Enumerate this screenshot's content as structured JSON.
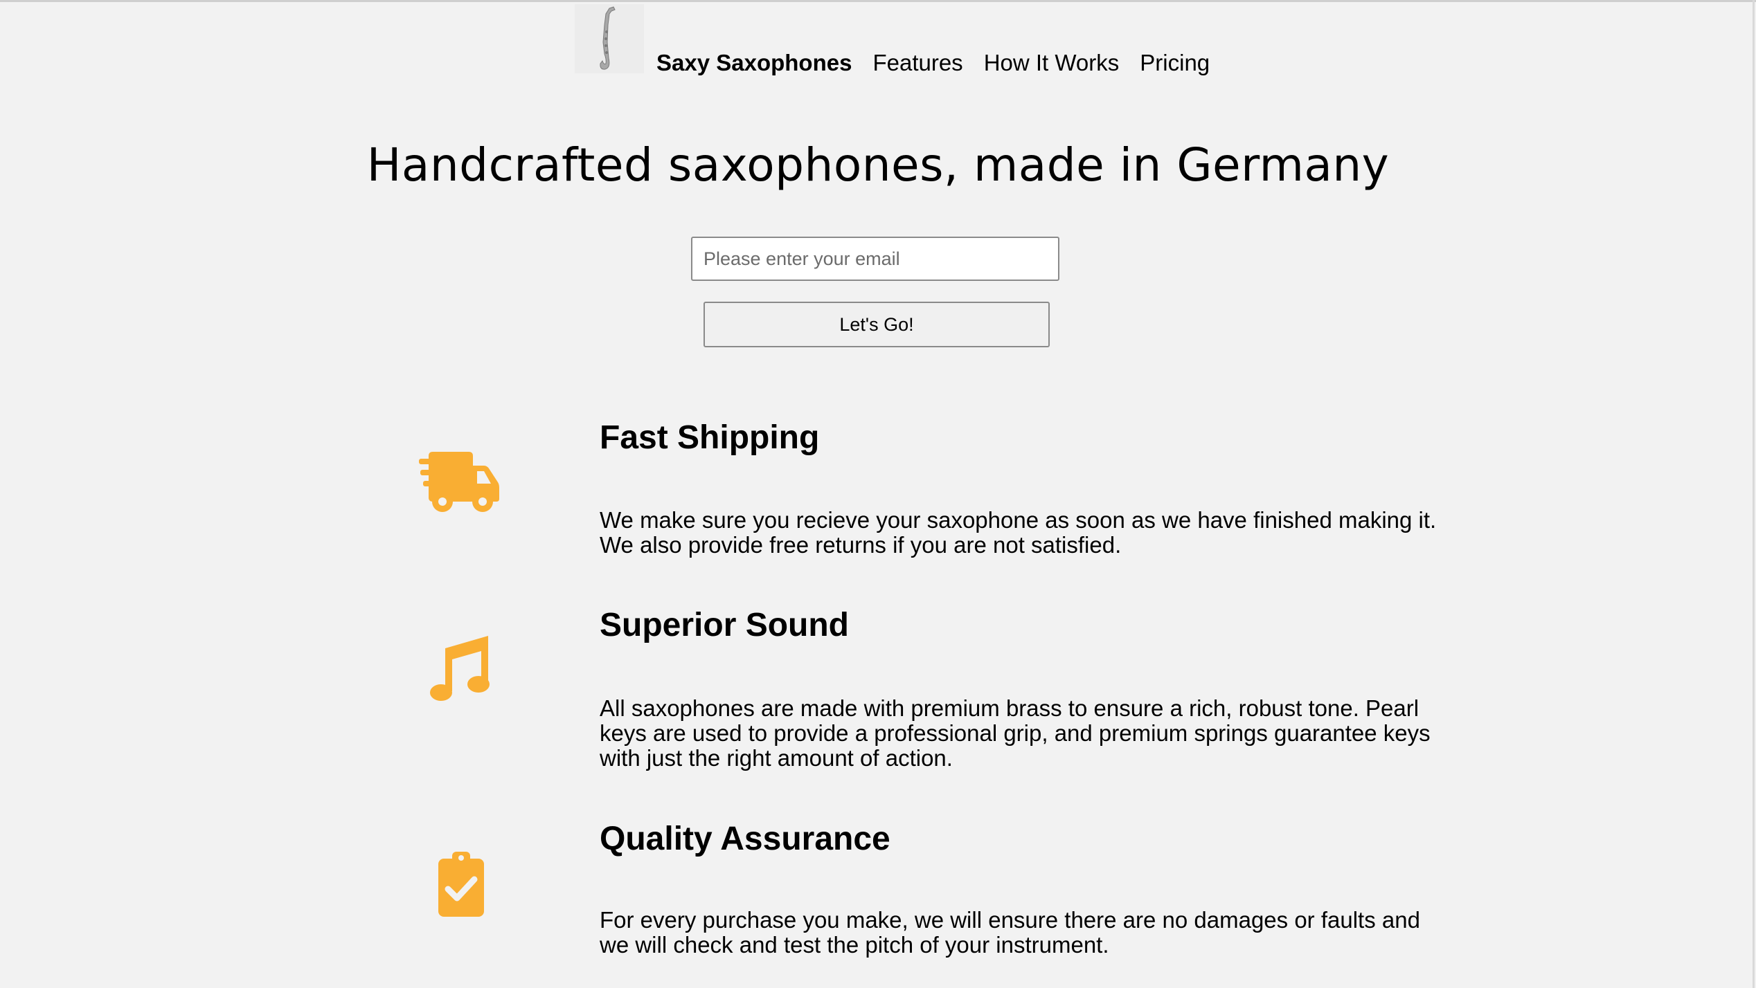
{
  "header": {
    "logo_icon": "saxophone-logo-image",
    "brand": "Saxy Saxophones",
    "nav": [
      "Features",
      "How It Works",
      "Pricing"
    ]
  },
  "hero": {
    "title": "Handcrafted saxophones, made in Germany",
    "email_placeholder": "Please enter your email",
    "button_label": "Let's Go!"
  },
  "features": [
    {
      "icon": "truck-icon",
      "title": "Fast Shipping",
      "text": "We make sure you recieve your saxophone as soon as we have finished making it. We also provide free returns if you are not satisfied."
    },
    {
      "icon": "music-note-icon",
      "title": "Superior Sound",
      "text": "All saxophones are made with premium brass to ensure a rich, robust tone. Pearl keys are used to provide a professional grip, and premium springs guarantee keys with just the right amount of action."
    },
    {
      "icon": "clipboard-check-icon",
      "title": "Quality Assurance",
      "text": "For every purchase you make, we will ensure there are no damages or faults and we will check and test the pitch of your instrument."
    }
  ],
  "colors": {
    "background": "#f2f2f2",
    "icon_accent": "#f9ae33",
    "text": "#000000"
  }
}
